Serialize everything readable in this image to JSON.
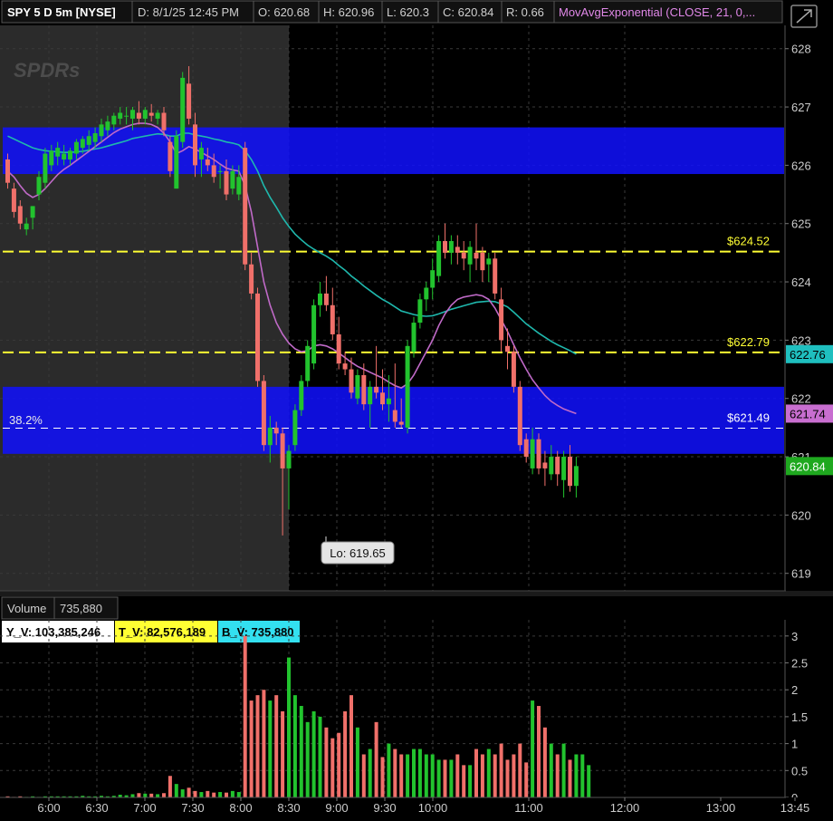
{
  "header": {
    "title": "SPY 5 D 5m [NYSE]",
    "date": "D: 8/1/25 12:45 PM",
    "open": "O: 620.68",
    "high": "H: 620.96",
    "low": "L: 620.3",
    "close": "C: 620.84",
    "range": "R: 0.66",
    "study": "MovAvgExponential (CLOSE, 21, 0,..."
  },
  "watermark": "SPDRs",
  "volume_header": {
    "label": "Volume",
    "value": "735,880"
  },
  "volume_badges": {
    "y_v": "Y_V: 103,385,246",
    "t_v": "T_V: 82,576,189",
    "b_v": "B_V: 735,880"
  },
  "annotations": {
    "fib": "38.2%",
    "low_bubble": "Lo: 619.65"
  },
  "price_badges": [
    {
      "text": "622.76",
      "price": 622.76,
      "bg": "#1fbfbf",
      "fg": "#000000"
    },
    {
      "text": "621.74",
      "price": 621.74,
      "bg": "#c86ed0",
      "fg": "#000000"
    },
    {
      "text": "620.84",
      "price": 620.84,
      "bg": "#1fa81f",
      "fg": "#ffffff"
    }
  ],
  "colors": {
    "up": "#22c32e",
    "down": "#f0706a",
    "zone": "#1010ff",
    "level": "#ffff33",
    "ema_fast": "#c06ac8",
    "ema_slow": "#1fb8ad",
    "premarket": "#2b2b2b"
  },
  "chart_data": [
    {
      "type": "candlestick",
      "symbol": "SPY",
      "interval": "5m",
      "y_ticks": [
        619,
        620,
        621,
        622,
        623,
        624,
        625,
        626,
        627,
        628
      ],
      "x_ticks": [
        "6:00",
        "6:30",
        "7:00",
        "7:30",
        "8:00",
        "8:30",
        "9:00",
        "9:30",
        "10:00",
        "11:00",
        "12:00",
        "13:00",
        "13:45"
      ],
      "x_tick_minutes": [
        360,
        390,
        420,
        450,
        480,
        510,
        540,
        570,
        600,
        660,
        720,
        780,
        825
      ],
      "start_minute": 300,
      "regular_session_start": 510,
      "ylim": [
        618.7,
        628.4
      ],
      "zones": [
        [
          625.85,
          626.65
        ],
        [
          621.05,
          622.2
        ]
      ],
      "levels": [
        {
          "price": 624.52,
          "label": "$624.52",
          "color": "#ffff33"
        },
        {
          "price": 622.79,
          "label": "$622.79",
          "color": "#ffff33"
        },
        {
          "price": 621.49,
          "label": "$621.49",
          "color": "#ffffff"
        }
      ],
      "ohlc": [
        [
          626.1,
          626.2,
          625.6,
          625.7
        ],
        [
          625.6,
          625.7,
          625.1,
          625.2
        ],
        [
          625.3,
          625.4,
          624.9,
          625.0
        ],
        [
          624.9,
          625.1,
          624.8,
          625.0
        ],
        [
          625.1,
          625.3,
          624.9,
          625.3
        ],
        [
          625.5,
          625.9,
          625.4,
          625.8
        ],
        [
          625.7,
          626.3,
          625.6,
          626.2
        ],
        [
          626.0,
          626.35,
          625.9,
          626.25
        ],
        [
          626.15,
          626.4,
          626.0,
          626.3
        ],
        [
          626.1,
          626.35,
          626.0,
          626.2
        ],
        [
          626.1,
          626.3,
          626.0,
          626.25
        ],
        [
          626.2,
          626.45,
          626.1,
          626.4
        ],
        [
          626.3,
          626.5,
          626.2,
          626.45
        ],
        [
          626.35,
          626.6,
          626.25,
          626.5
        ],
        [
          626.4,
          626.65,
          626.3,
          626.55
        ],
        [
          626.5,
          626.8,
          626.4,
          626.7
        ],
        [
          626.6,
          626.85,
          626.5,
          626.75
        ],
        [
          626.7,
          626.9,
          626.6,
          626.85
        ],
        [
          626.8,
          627.0,
          626.7,
          626.9
        ],
        [
          626.85,
          627.0,
          626.7,
          626.85
        ],
        [
          626.8,
          627.0,
          626.6,
          626.95
        ],
        [
          626.9,
          627.1,
          626.7,
          626.8
        ],
        [
          626.8,
          627.0,
          626.7,
          626.95
        ],
        [
          626.9,
          627.05,
          626.75,
          626.85
        ],
        [
          626.8,
          626.95,
          626.7,
          626.9
        ],
        [
          626.9,
          627.0,
          626.5,
          626.6
        ],
        [
          626.4,
          626.5,
          625.8,
          625.9
        ],
        [
          625.6,
          626.6,
          625.6,
          626.5
        ],
        [
          626.4,
          627.6,
          626.3,
          627.5
        ],
        [
          627.4,
          627.7,
          626.7,
          626.8
        ],
        [
          626.7,
          626.9,
          625.8,
          626.0
        ],
        [
          626.1,
          626.4,
          625.8,
          626.3
        ],
        [
          626.1,
          626.3,
          625.9,
          626.0
        ],
        [
          626.0,
          626.2,
          625.7,
          625.8
        ],
        [
          625.9,
          626.0,
          625.6,
          625.9
        ],
        [
          625.9,
          626.1,
          625.4,
          625.5
        ],
        [
          625.6,
          626.0,
          625.5,
          625.9
        ],
        [
          625.5,
          626.0,
          625.4,
          625.8
        ],
        [
          626.3,
          626.4,
          624.2,
          624.3
        ],
        [
          624.3,
          624.5,
          623.7,
          623.8
        ],
        [
          623.8,
          623.9,
          622.2,
          622.3
        ],
        [
          622.3,
          622.4,
          621.1,
          621.2
        ],
        [
          621.2,
          621.7,
          620.9,
          621.5
        ],
        [
          621.5,
          621.6,
          621.2,
          621.4
        ],
        [
          621.4,
          621.5,
          619.65,
          620.8
        ],
        [
          620.8,
          621.2,
          620.1,
          621.1
        ],
        [
          621.2,
          621.9,
          621.1,
          621.8
        ],
        [
          621.8,
          622.4,
          621.7,
          622.3
        ],
        [
          622.3,
          623.0,
          622.2,
          622.9
        ],
        [
          622.6,
          623.7,
          622.5,
          623.6
        ],
        [
          623.6,
          624.0,
          623.4,
          623.8
        ],
        [
          623.8,
          624.1,
          623.5,
          623.6
        ],
        [
          623.6,
          623.9,
          623.0,
          623.1
        ],
        [
          623.1,
          623.4,
          622.5,
          622.6
        ],
        [
          622.6,
          622.8,
          622.4,
          622.5
        ],
        [
          622.5,
          622.7,
          622.0,
          622.1
        ],
        [
          622.0,
          622.5,
          621.9,
          622.4
        ],
        [
          622.4,
          622.6,
          621.8,
          621.9
        ],
        [
          621.9,
          622.3,
          621.5,
          622.2
        ],
        [
          622.2,
          622.9,
          622.0,
          622.1
        ],
        [
          622.1,
          622.5,
          621.8,
          621.9
        ],
        [
          621.9,
          622.4,
          621.6,
          622.0
        ],
        [
          621.8,
          622.6,
          621.5,
          621.6
        ],
        [
          621.6,
          622.0,
          621.5,
          621.55
        ],
        [
          621.5,
          623.0,
          621.4,
          622.9
        ],
        [
          622.8,
          623.4,
          622.7,
          623.3
        ],
        [
          623.3,
          623.8,
          623.2,
          623.7
        ],
        [
          623.7,
          624.0,
          623.5,
          623.9
        ],
        [
          623.9,
          624.4,
          623.7,
          624.2
        ],
        [
          624.1,
          624.8,
          624.0,
          624.7
        ],
        [
          624.7,
          625.0,
          624.4,
          624.5
        ],
        [
          624.5,
          624.8,
          624.3,
          624.7
        ],
        [
          624.6,
          624.8,
          624.3,
          624.5
        ],
        [
          624.5,
          624.7,
          624.2,
          624.4
        ],
        [
          624.3,
          624.7,
          624.0,
          624.6
        ],
        [
          624.5,
          625.0,
          624.2,
          624.4
        ],
        [
          624.5,
          624.6,
          624.0,
          624.2
        ],
        [
          624.3,
          624.5,
          624.0,
          624.4
        ],
        [
          624.4,
          624.5,
          623.7,
          623.8
        ],
        [
          623.7,
          623.9,
          622.8,
          623.0
        ],
        [
          622.9,
          623.2,
          622.5,
          622.8
        ],
        [
          622.8,
          622.9,
          622.1,
          622.2
        ],
        [
          622.2,
          622.3,
          621.1,
          621.2
        ],
        [
          621.3,
          621.4,
          620.9,
          621.0
        ],
        [
          620.8,
          621.5,
          620.7,
          621.3
        ],
        [
          621.3,
          621.4,
          620.7,
          620.8
        ],
        [
          620.9,
          621.1,
          620.5,
          620.8
        ],
        [
          620.7,
          621.2,
          620.6,
          621.0
        ],
        [
          621.0,
          621.1,
          620.5,
          620.7
        ],
        [
          620.6,
          621.1,
          620.3,
          621.0
        ],
        [
          621.0,
          621.2,
          620.4,
          620.5
        ],
        [
          620.5,
          621.0,
          620.3,
          620.84
        ]
      ],
      "ema_21": [
        626.5,
        626.45,
        626.4,
        626.35,
        626.3,
        626.27,
        626.25,
        626.24,
        626.23,
        626.22,
        626.22,
        626.23,
        626.24,
        626.26,
        626.28,
        626.3,
        626.33,
        626.36,
        626.39,
        626.42,
        626.46,
        626.48,
        626.5,
        626.52,
        626.54,
        626.53,
        626.5,
        626.5,
        626.55,
        626.55,
        626.52,
        626.5,
        626.48,
        626.45,
        626.43,
        626.4,
        626.38,
        626.35,
        626.25,
        626.1,
        625.9,
        625.65,
        625.45,
        625.28,
        625.1,
        624.95,
        624.82,
        624.72,
        624.63,
        624.56,
        624.5,
        624.44,
        624.37,
        624.28,
        624.2,
        624.1,
        624.02,
        623.93,
        623.85,
        623.77,
        623.7,
        623.64,
        623.57,
        623.5,
        623.47,
        623.44,
        623.42,
        623.41,
        623.42,
        623.45,
        623.49,
        623.53,
        623.56,
        623.59,
        623.62,
        623.65,
        623.66,
        623.67,
        623.66,
        623.62,
        623.57,
        623.48,
        623.38,
        623.28,
        623.2,
        623.12,
        623.05,
        622.98,
        622.92,
        622.87,
        622.82,
        622.76
      ],
      "ema_9": [
        625.9,
        625.8,
        625.65,
        625.52,
        625.45,
        625.5,
        625.6,
        625.72,
        625.84,
        625.93,
        626.0,
        626.08,
        626.16,
        626.24,
        626.32,
        626.4,
        626.48,
        626.56,
        626.62,
        626.66,
        626.7,
        626.72,
        626.72,
        626.7,
        626.65,
        626.55,
        626.4,
        626.2,
        626.25,
        626.32,
        626.28,
        626.22,
        626.16,
        626.1,
        626.02,
        625.95,
        625.92,
        625.9,
        625.65,
        625.2,
        624.6,
        624.0,
        623.6,
        623.3,
        623.1,
        622.95,
        622.85,
        622.8,
        622.82,
        622.9,
        622.92,
        622.9,
        622.85,
        622.78,
        622.7,
        622.62,
        622.55,
        622.5,
        622.45,
        622.4,
        622.35,
        622.28,
        622.22,
        622.18,
        622.25,
        622.4,
        622.6,
        622.8,
        623.0,
        623.25,
        623.45,
        623.6,
        623.7,
        623.74,
        623.76,
        623.78,
        623.76,
        623.7,
        623.55,
        623.35,
        623.15,
        622.92,
        622.7,
        622.5,
        622.32,
        622.18,
        622.05,
        621.95,
        621.88,
        621.82,
        621.78,
        621.74
      ]
    },
    {
      "type": "bar",
      "title": "Volume",
      "y_ticks": [
        0,
        0.5,
        1,
        1.5,
        2,
        2.5,
        3
      ],
      "ylim": [
        0,
        3.3
      ],
      "values": [
        0.02,
        0.01,
        0.02,
        0.01,
        0.02,
        0.01,
        0.02,
        0.02,
        0.02,
        0.02,
        0.02,
        0.02,
        0.03,
        0.02,
        0.02,
        0.03,
        0.02,
        0.03,
        0.05,
        0.04,
        0.06,
        0.08,
        0.07,
        0.07,
        0.06,
        0.08,
        0.4,
        0.25,
        0.15,
        0.18,
        0.12,
        0.1,
        0.12,
        0.09,
        0.1,
        0.09,
        0.12,
        0.1,
        3.0,
        1.8,
        1.9,
        2.0,
        1.8,
        1.9,
        1.6,
        2.6,
        1.9,
        1.7,
        1.4,
        1.6,
        1.5,
        1.3,
        1.1,
        1.2,
        1.6,
        1.9,
        1.3,
        0.8,
        0.9,
        1.4,
        0.75,
        1.0,
        0.9,
        0.8,
        0.8,
        0.9,
        0.9,
        0.8,
        0.8,
        0.7,
        0.7,
        0.7,
        0.8,
        0.6,
        0.6,
        0.9,
        0.8,
        0.9,
        0.8,
        1.0,
        0.7,
        0.8,
        1.0,
        0.65,
        1.8,
        1.7,
        1.3,
        1.0,
        0.8,
        1.0,
        0.7,
        0.8,
        0.8,
        0.6
      ]
    }
  ]
}
